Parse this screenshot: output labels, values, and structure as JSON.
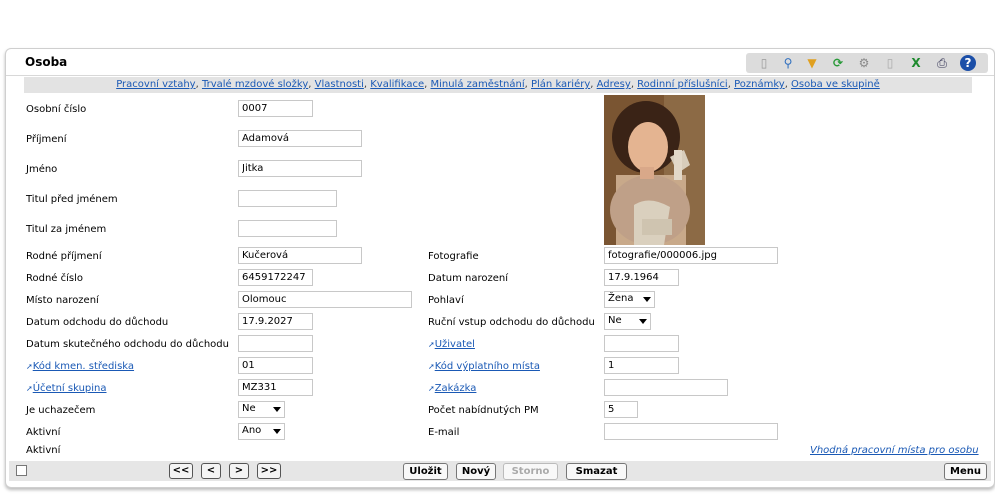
{
  "title": "Osoba",
  "toolbar_icons": [
    "new-document-icon",
    "search-icon",
    "filter-icon",
    "refresh-icon",
    "settings-icon",
    "document-icon",
    "excel-export-icon",
    "print-icon",
    "help-icon"
  ],
  "links": [
    "Pracovní vztahy",
    "Trvalé mzdové složky",
    "Vlastnosti",
    "Kvalifikace",
    "Minulá zaměstnání",
    "Plán kariéry",
    "Adresy",
    "Rodinní příslušníci",
    "Poznámky",
    "Osoba ve skupině"
  ],
  "fields": {
    "osobni_cislo": {
      "label": "Osobní číslo",
      "value": "0007"
    },
    "prijmeni": {
      "label": "Příjmení",
      "value": "Adamová"
    },
    "jmeno": {
      "label": "Jméno",
      "value": "Jitka"
    },
    "titul_pred": {
      "label": "Titul před jménem",
      "value": ""
    },
    "titul_za": {
      "label": "Titul za jménem",
      "value": ""
    },
    "rodne_prijmeni": {
      "label": "Rodné příjmení",
      "value": "Kučerová"
    },
    "rodne_cislo": {
      "label": "Rodné číslo",
      "value": "6459172247"
    },
    "misto_narozeni": {
      "label": "Místo narození",
      "value": "Olomouc"
    },
    "datum_odchodu": {
      "label": "Datum odchodu do důchodu",
      "value": "17.9.2027"
    },
    "datum_skutecneho": {
      "label": "Datum skutečného odchodu do důchodu",
      "value": ""
    },
    "kod_strediska": {
      "label": "Kód kmen. střediska",
      "value": "01"
    },
    "ucetni_skupina": {
      "label": "Účetní skupina",
      "value": "MZ331"
    },
    "je_uchazecem": {
      "label": "Je uchazečem",
      "value": "Ne"
    },
    "aktivni": {
      "label": "Aktivní",
      "value": "Ano"
    },
    "aktivni2": {
      "label": "Aktivní"
    },
    "fotografie": {
      "label": "Fotografie",
      "value": "fotografie/000006.jpg"
    },
    "datum_narozeni": {
      "label": "Datum narození",
      "value": "17.9.1964"
    },
    "pohlavi": {
      "label": "Pohlaví",
      "value": "Žena"
    },
    "rucni_vstup": {
      "label": "Ruční vstup odchodu do důchodu",
      "value": "Ne"
    },
    "uzivatel": {
      "label": "Uživatel",
      "value": ""
    },
    "kod_vyplatniho": {
      "label": "Kód výplatního místa",
      "value": "1"
    },
    "zakazka": {
      "label": "Zakázka",
      "value": ""
    },
    "pocet_pm": {
      "label": "Počet nabídnutých PM",
      "value": "5"
    },
    "email": {
      "label": "E-mail",
      "value": ""
    }
  },
  "suitable_link": "Vhodná pracovní místa pro osobu",
  "nav": {
    "first": "<<",
    "prev": "<",
    "next": ">",
    "last": ">>"
  },
  "actions": {
    "save": "Uložit",
    "new": "Nový",
    "cancel": "Storno",
    "delete": "Smazat"
  },
  "menu": "Menu"
}
